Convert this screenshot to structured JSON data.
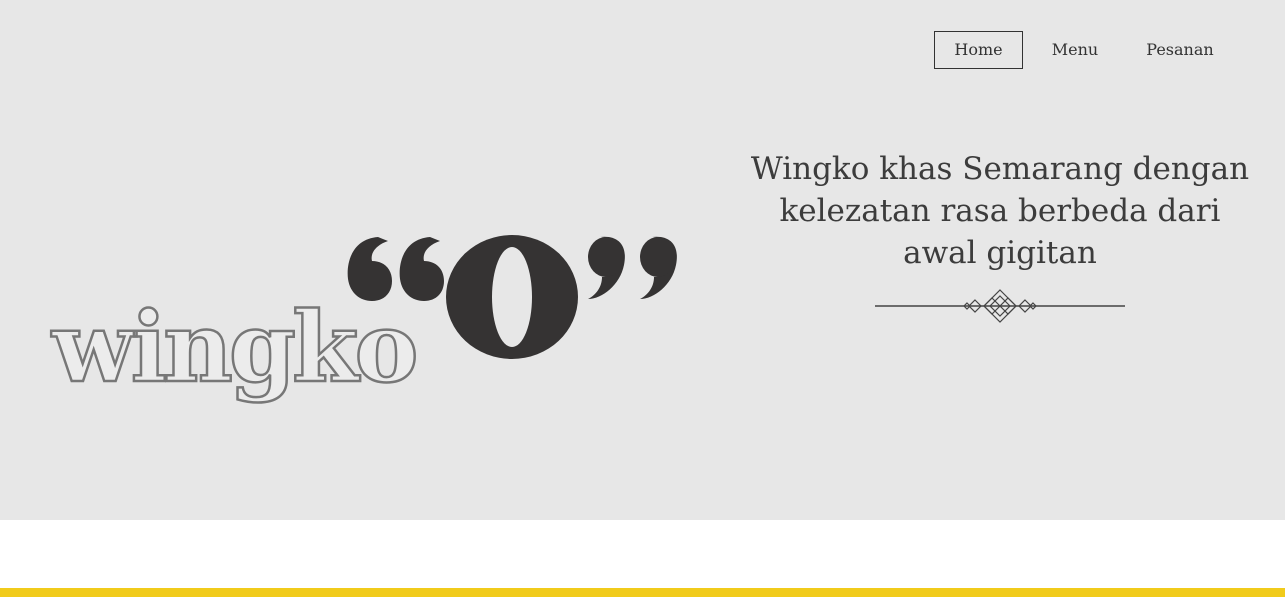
{
  "nav": {
    "items": [
      {
        "label": "Home",
        "active": true
      },
      {
        "label": "Menu",
        "active": false
      },
      {
        "label": "Pesanan",
        "active": false
      }
    ]
  },
  "logo": {
    "word": "wingko",
    "letter": "O"
  },
  "hero": {
    "tagline_line1": "Wingko khas Semarang dengan",
    "tagline_line2": "kelezatan rasa berbeda dari",
    "tagline_line3": "awal gigitan"
  },
  "colors": {
    "hero_bg": "#e7e7e7",
    "text": "#333333",
    "accent": "#f1cb1b"
  }
}
